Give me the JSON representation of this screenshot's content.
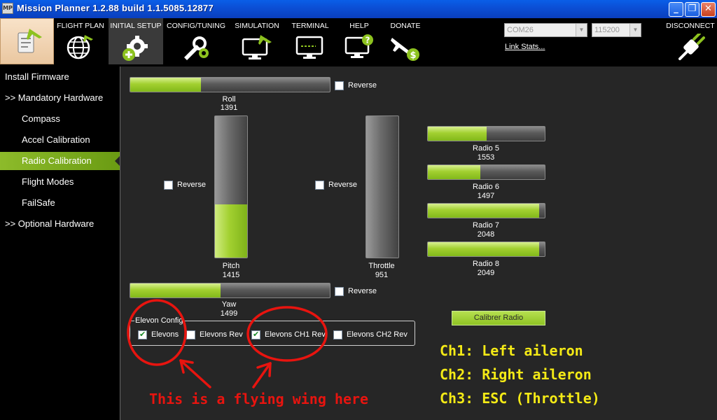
{
  "window": {
    "title": "Mission Planner 1.2.88 build 1.1.5085.12877",
    "icon_text": "MP",
    "controls": {
      "minimize": "_",
      "maximize": "❐",
      "close": "✕"
    }
  },
  "toolbar": {
    "items": [
      {
        "label": "FLIGHT PLAN",
        "icon": "globe-icon"
      },
      {
        "label": "INITIAL SETUP",
        "icon": "gear-plus-icon"
      },
      {
        "label": "CONFIG/TUNING",
        "icon": "wrench-gear-icon"
      },
      {
        "label": "SIMULATION",
        "icon": "monitor-plane-icon"
      },
      {
        "label": "TERMINAL",
        "icon": "terminal-icon"
      },
      {
        "label": "HELP",
        "icon": "help-monitor-icon"
      },
      {
        "label": "DONATE",
        "icon": "plane-dollar-icon"
      }
    ],
    "port": "COM26",
    "baud": "115200",
    "link_stats": "Link Stats...",
    "disconnect": "DISCONNECT"
  },
  "sidebar": {
    "items": [
      {
        "label": "Install Firmware"
      },
      {
        "label": ">> Mandatory Hardware"
      },
      {
        "label": "Compass"
      },
      {
        "label": "Accel Calibration"
      },
      {
        "label": "Radio Calibration"
      },
      {
        "label": "Flight Modes"
      },
      {
        "label": "FailSafe"
      },
      {
        "label": ">> Optional Hardware"
      }
    ],
    "active": "Radio Calibration"
  },
  "radio": {
    "range": [
      1000,
      2100
    ],
    "roll": {
      "name": "Roll",
      "value": 1391,
      "reverse_label": "Reverse",
      "reversed": false
    },
    "pitch": {
      "name": "Pitch",
      "value": 1415,
      "reverse_label": "Reverse",
      "reversed": false
    },
    "throttle": {
      "name": "Throttle",
      "value": 951,
      "reverse_label": "Reverse",
      "reversed": false
    },
    "yaw": {
      "name": "Yaw",
      "value": 1499,
      "reverse_label": "Reverse",
      "reversed": false
    },
    "aux": [
      {
        "name": "Radio 5",
        "value": 1553
      },
      {
        "name": "Radio 6",
        "value": 1497
      },
      {
        "name": "Radio 7",
        "value": 2048
      },
      {
        "name": "Radio 8",
        "value": 2049
      }
    ],
    "calibrate_button": "Calibrer Radio"
  },
  "elevon": {
    "group_title": "Elevon Config",
    "options": [
      {
        "label": "Elevons",
        "checked": true
      },
      {
        "label": "Elevons Rev",
        "checked": false
      },
      {
        "label": "Elevons CH1 Rev",
        "checked": true
      },
      {
        "label": "Elevons CH2 Rev",
        "checked": false
      }
    ]
  },
  "annotations": {
    "note": "This is a flying wing here",
    "channels": [
      "Ch1: Left aileron",
      "Ch2: Right aileron",
      "Ch3: ESC (Throttle)"
    ]
  },
  "colors": {
    "accent_green": "#a2d030",
    "annotation_red": "#e8140f",
    "annotation_yellow": "#f4ea16",
    "titlebar_blue": "#0b4fd6"
  }
}
